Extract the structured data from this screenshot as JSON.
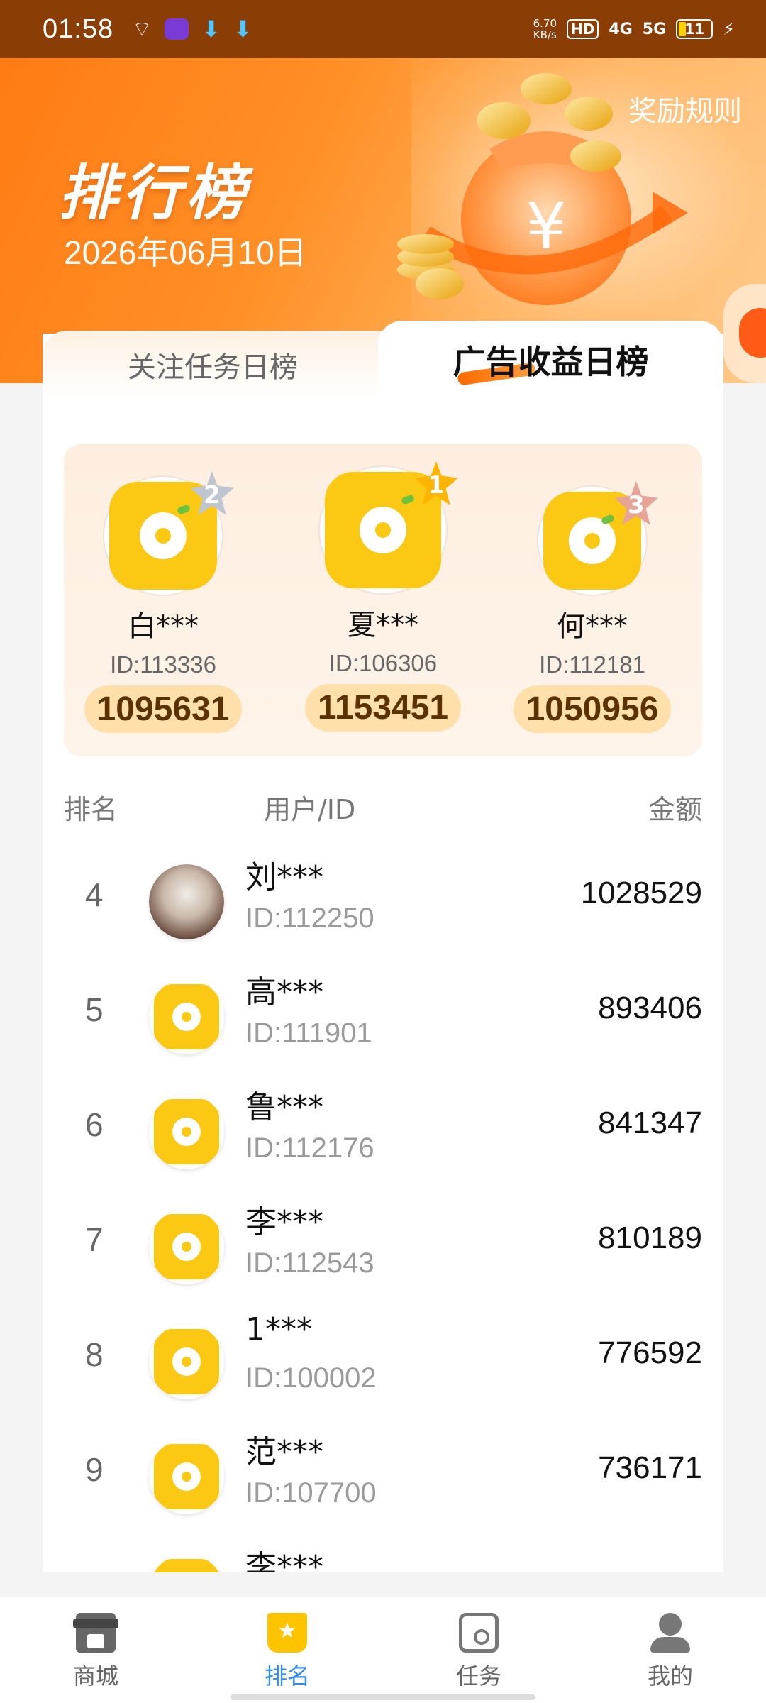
{
  "status_bar": {
    "time": "01:58",
    "net_speed_top": "6.70",
    "net_speed_bottom": "KB/s",
    "hd": "HD",
    "sig1": "4G",
    "sig2": "5G",
    "battery": "11"
  },
  "header": {
    "title": "排行榜",
    "date": "2026年06月10日",
    "rules_link": "奖励规则"
  },
  "tabs": [
    {
      "label": "关注任务日榜",
      "active": false
    },
    {
      "label": "广告收益日榜",
      "active": true
    }
  ],
  "podium": [
    {
      "rank": "2",
      "name": "白***",
      "id": "ID:113336",
      "amount": "1095631"
    },
    {
      "rank": "1",
      "name": "夏***",
      "id": "ID:106306",
      "amount": "1153451"
    },
    {
      "rank": "3",
      "name": "何***",
      "id": "ID:112181",
      "amount": "1050956"
    }
  ],
  "list_header": {
    "rank": "排名",
    "user": "用户/ID",
    "amount": "金额"
  },
  "rows": [
    {
      "rank": "4",
      "name": "刘***",
      "id": "ID:112250",
      "amount": "1028529",
      "avatar": "photo"
    },
    {
      "rank": "5",
      "name": "高***",
      "id": "ID:111901",
      "amount": "893406",
      "avatar": "app-logo"
    },
    {
      "rank": "6",
      "name": "鲁***",
      "id": "ID:112176",
      "amount": "841347",
      "avatar": "app-logo"
    },
    {
      "rank": "7",
      "name": "李***",
      "id": "ID:112543",
      "amount": "810189",
      "avatar": "app-logo"
    },
    {
      "rank": "8",
      "name": "1***",
      "id": "ID:100002",
      "amount": "776592",
      "avatar": "app-logo"
    },
    {
      "rank": "9",
      "name": "范***",
      "id": "ID:107700",
      "amount": "736171",
      "avatar": "app-logo"
    },
    {
      "rank": "",
      "name": "李***",
      "id": "",
      "amount": "",
      "avatar": "app-logo"
    }
  ],
  "bottom_nav": [
    {
      "label": "商城",
      "icon": "shop-icon",
      "active": false
    },
    {
      "label": "排名",
      "icon": "ranking-icon",
      "active": true
    },
    {
      "label": "任务",
      "icon": "task-icon",
      "active": false
    },
    {
      "label": "我的",
      "icon": "profile-icon",
      "active": false
    }
  ],
  "colors": {
    "accent_orange": "#ff7a12",
    "active_blue": "#2f8cf0",
    "app_yellow": "#fbc913"
  }
}
